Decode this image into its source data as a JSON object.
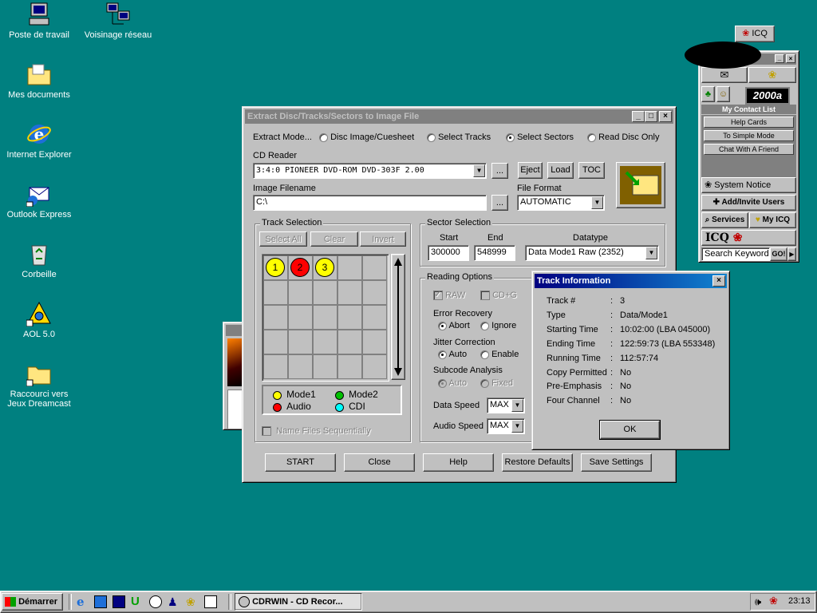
{
  "desktop": {
    "icons": [
      {
        "label": "Poste de travail"
      },
      {
        "label": "Voisinage réseau"
      },
      {
        "label": "Mes documents"
      },
      {
        "label": "Internet Explorer"
      },
      {
        "label": "Outlook Express"
      },
      {
        "label": "Corbeille"
      },
      {
        "label": "AOL 5.0"
      },
      {
        "label": "Raccourci vers Jeux Dreamcast"
      }
    ]
  },
  "extract_window": {
    "title": "Extract Disc/Tracks/Sectors to Image File",
    "extract_mode_label": "Extract Mode...",
    "modes": [
      "Disc Image/Cuesheet",
      "Select Tracks",
      "Select Sectors",
      "Read Disc Only"
    ],
    "selected_mode": "Select Sectors",
    "cd_reader_label": "CD Reader",
    "cd_reader_value": "3:4:0 PIONEER  DVD-ROM DVD-303F 2.00",
    "browse_label": "...",
    "eject_label": "Eject",
    "load_label": "Load",
    "toc_label": "TOC",
    "image_filename_label": "Image Filename",
    "image_filename_value": "C:\\",
    "file_format_label": "File Format",
    "file_format_value": "AUTOMATIC",
    "track_selection": {
      "label": "Track Selection",
      "select_all": "Select All",
      "clear": "Clear",
      "invert": "Invert",
      "tracks": [
        "1",
        "2",
        "3"
      ],
      "legend": [
        "Mode1",
        "Mode2",
        "Audio",
        "CDI"
      ],
      "name_files_sequentially": "Name Files Sequentially"
    },
    "sector_selection": {
      "label": "Sector Selection",
      "start_label": "Start",
      "end_label": "End",
      "datatype_label": "Datatype",
      "start_value": "300000",
      "end_value": "548999",
      "datatype_value": "Data  Mode1 Raw (2352)"
    },
    "reading_options": {
      "label": "Reading Options",
      "raw": "RAW",
      "cdg": "CD+G",
      "error_recovery_label": "Error Recovery",
      "error_recovery": [
        "Abort",
        "Ignore"
      ],
      "jitter_label": "Jitter Correction",
      "jitter": [
        "Auto",
        "Enable"
      ],
      "subcode_label": "Subcode Analysis",
      "subcode": [
        "Auto",
        "Fixed"
      ],
      "data_speed_label": "Data Speed",
      "data_speed_value": "MAX",
      "audio_speed_label": "Audio Speed",
      "audio_speed_value": "MAX"
    },
    "buttons": [
      "START",
      "Close",
      "Help",
      "Restore Defaults",
      "Save Settings"
    ]
  },
  "track_info": {
    "title": "Track Information",
    "rows": [
      {
        "key": "Track #",
        "value": "3"
      },
      {
        "key": "Type",
        "value": "Data/Mode1"
      },
      {
        "key": "Starting Time",
        "value": "10:02:00 (LBA 045000)"
      },
      {
        "key": "Ending Time",
        "value": "122:59:73 (LBA 553348)"
      },
      {
        "key": "Running Time",
        "value": "112:57:74"
      },
      {
        "key": "Copy Permitted",
        "value": "No"
      },
      {
        "key": "Pre-Emphasis",
        "value": "No"
      },
      {
        "key": "Four Channel",
        "value": "No"
      }
    ],
    "separator": ":",
    "ok_label": "OK"
  },
  "icq": {
    "tab_label": "ICQ",
    "logo_text": "2000a",
    "contact_list": "My Contact List",
    "help_cards": "Help Cards",
    "simple_mode": "To Simple Mode",
    "chat": "Chat With A Friend",
    "system_notice": "System Notice",
    "add_invite": "Add/Invite Users",
    "services": "Services",
    "my_icq": "My ICQ",
    "icq_brand": "ICQ",
    "search_keyword": "Search Keyword",
    "go": "GO!"
  },
  "taskbar": {
    "start_label": "Démarrer",
    "task_label": "CDRWIN - CD Recor...",
    "clock": "23:13"
  },
  "colors": {
    "desktop": "#008080",
    "track_mode1": "#ffff00",
    "track_audio": "#ff0000",
    "legend_mode2": "#00c000",
    "legend_cdi": "#00ffff"
  }
}
